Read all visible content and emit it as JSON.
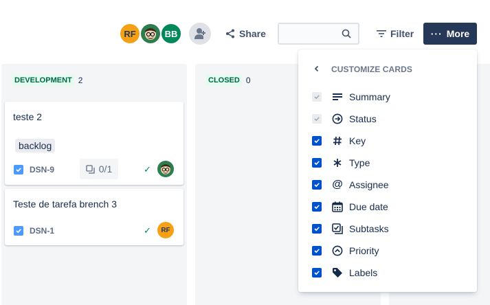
{
  "header": {
    "avatars": [
      {
        "initials": "RF",
        "color": "#f5a015"
      },
      {
        "initials": "",
        "color": "#2e7d4f"
      },
      {
        "initials": "BB",
        "color": "#00875a"
      }
    ],
    "share_label": "Share",
    "search_value": "",
    "filter_label": "Filter",
    "more_label": "More"
  },
  "columns": [
    {
      "name": "DEVELOPMENT",
      "count": "2",
      "cards": [
        {
          "title": "teste 2",
          "label": "backlog",
          "key": "DSN-9",
          "subtasks": "0/1",
          "assignee": "face"
        },
        {
          "title": "Teste de tarefa brench 3",
          "key": "DSN-1",
          "assignee": "RF"
        }
      ]
    },
    {
      "name": "CLOSED",
      "count": "0"
    }
  ],
  "customize_menu": {
    "title": "CUSTOMIZE CARDS",
    "items": [
      {
        "label": "Summary",
        "icon": "summary-lines-icon",
        "checked": true,
        "disabled": true
      },
      {
        "label": "Status",
        "icon": "status-arrow-circle-icon",
        "checked": true,
        "disabled": true
      },
      {
        "label": "Key",
        "icon": "hash-icon",
        "checked": true
      },
      {
        "label": "Type",
        "icon": "asterisk-icon",
        "checked": true
      },
      {
        "label": "Assignee",
        "icon": "at-sign-icon",
        "checked": true
      },
      {
        "label": "Due date",
        "icon": "calendar-icon",
        "checked": true
      },
      {
        "label": "Subtasks",
        "icon": "subtasks-icon",
        "checked": true
      },
      {
        "label": "Priority",
        "icon": "priority-chevron-icon",
        "checked": true
      },
      {
        "label": "Labels",
        "icon": "tag-icon",
        "checked": true
      }
    ]
  },
  "colors": {
    "primary": "#0052cc",
    "dark_button": "#253858",
    "column_bg": "#f4f5f7",
    "done_green": "#00875a"
  }
}
